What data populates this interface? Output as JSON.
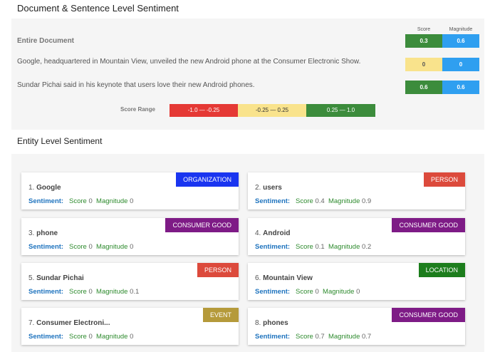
{
  "doc_title": "Document & Sentence Level Sentiment",
  "columns": {
    "score": "Score",
    "magnitude": "Magnitude"
  },
  "rows": [
    {
      "text": "Entire Document",
      "score": "0.3",
      "magnitude": "0.6",
      "score_color": "#3c8c3c",
      "mag_color": "#2f9ff0"
    },
    {
      "text": "Google, headquartered in Mountain View, unveiled the new Android phone at the Consumer Electronic Show.",
      "score": "0",
      "magnitude": "0",
      "score_color": "#f9e38c",
      "mag_color": "#2f9ff0"
    },
    {
      "text": "Sundar Pichai said in his keynote that users love their new Android phones.",
      "score": "0.6",
      "magnitude": "0.6",
      "score_color": "#3c8c3c",
      "mag_color": "#2f9ff0"
    }
  ],
  "score_range": {
    "label": "Score Range",
    "negative": "-1.0 — -0.25",
    "neutral": "-0.25 — 0.25",
    "positive": "0.25 — 1.0",
    "negative_color": "#e53935",
    "neutral_color": "#f9e38c",
    "positive_color": "#3c8c3c"
  },
  "entity_title": "Entity Level Sentiment",
  "sentiment_label": "Sentiment:",
  "score_word": "Score",
  "magnitude_word": "Magnitude",
  "entities": [
    {
      "index": "1.",
      "name": "Google",
      "type": "ORGANIZATION",
      "type_color": "#1a35f0",
      "score": "0",
      "magnitude": "0"
    },
    {
      "index": "2.",
      "name": "users",
      "type": "PERSON",
      "type_color": "#dc4a3c",
      "score": "0.4",
      "magnitude": "0.9"
    },
    {
      "index": "3.",
      "name": "phone",
      "type": "CONSUMER GOOD",
      "type_color": "#7e1b86",
      "score": "0",
      "magnitude": "0"
    },
    {
      "index": "4.",
      "name": "Android",
      "type": "CONSUMER GOOD",
      "type_color": "#7e1b86",
      "score": "0.1",
      "magnitude": "0.2"
    },
    {
      "index": "5.",
      "name": "Sundar Pichai",
      "type": "PERSON",
      "type_color": "#dc4a3c",
      "score": "0",
      "magnitude": "0.1"
    },
    {
      "index": "6.",
      "name": "Mountain View",
      "type": "LOCATION",
      "type_color": "#1c7d1c",
      "score": "0",
      "magnitude": "0"
    },
    {
      "index": "7.",
      "name": "Consumer Electroni...",
      "type": "EVENT",
      "type_color": "#b59a3a",
      "score": "0",
      "magnitude": "0"
    },
    {
      "index": "8.",
      "name": "phones",
      "type": "CONSUMER GOOD",
      "type_color": "#7e1b86",
      "score": "0.7",
      "magnitude": "0.7"
    }
  ]
}
